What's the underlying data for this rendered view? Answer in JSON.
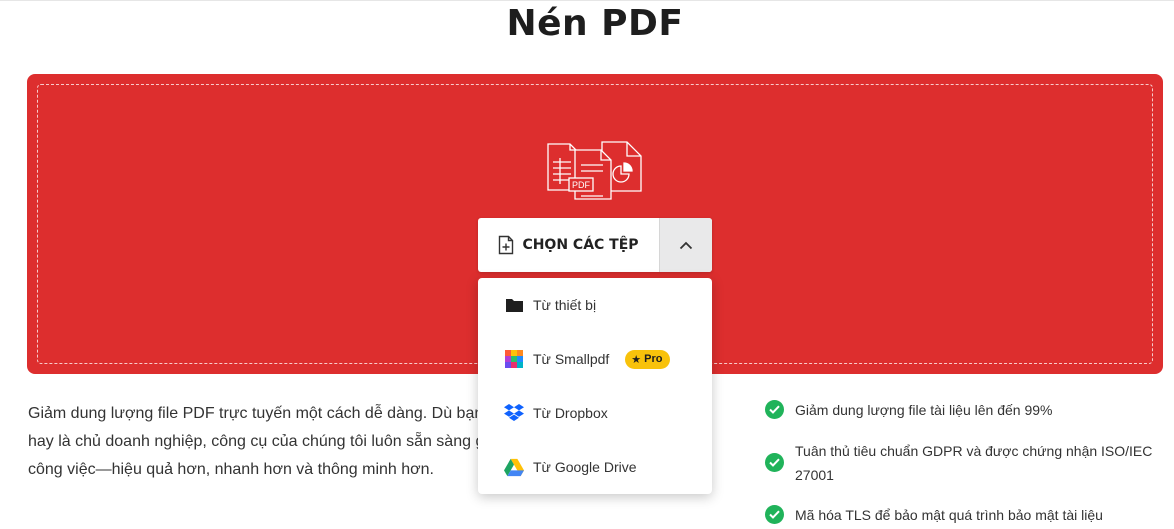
{
  "page": {
    "title": "Nén PDF"
  },
  "upload": {
    "choose_label": "CHỌN CÁC TỆP",
    "illustration_tag": "PDF",
    "options": [
      {
        "label": "Từ thiết bị",
        "icon": "folder-icon"
      },
      {
        "label": "Từ Smallpdf",
        "icon": "smallpdf-icon",
        "badge": "Pro"
      },
      {
        "label": "Từ Dropbox",
        "icon": "dropbox-icon"
      },
      {
        "label": "Từ Google Drive",
        "icon": "google-drive-icon"
      }
    ]
  },
  "description": {
    "lines": [
      "Giảm dung lượng file PDF trực tuyến một cách dễ dàng. Dù bạn là sinh viên",
      "hay là chủ doanh nghiệp, công cụ của chúng tôi luôn sẵn sàng giúp bạn",
      "công việc—hiệu quả hơn, nhanh hơn và thông minh hơn."
    ]
  },
  "features": [
    {
      "text": "Giảm dung lượng file tài liệu lên đến 99%"
    },
    {
      "text": "Tuân thủ tiêu chuẩn GDPR và được chứng nhận ISO/IEC 27001"
    },
    {
      "text": "Mã hóa TLS để bảo mật quá trình bảo mật tài liệu"
    }
  ],
  "colors": {
    "brand_red": "#dd2e2e",
    "pro_yellow": "#f8c20b",
    "check_green": "#20b35a"
  }
}
